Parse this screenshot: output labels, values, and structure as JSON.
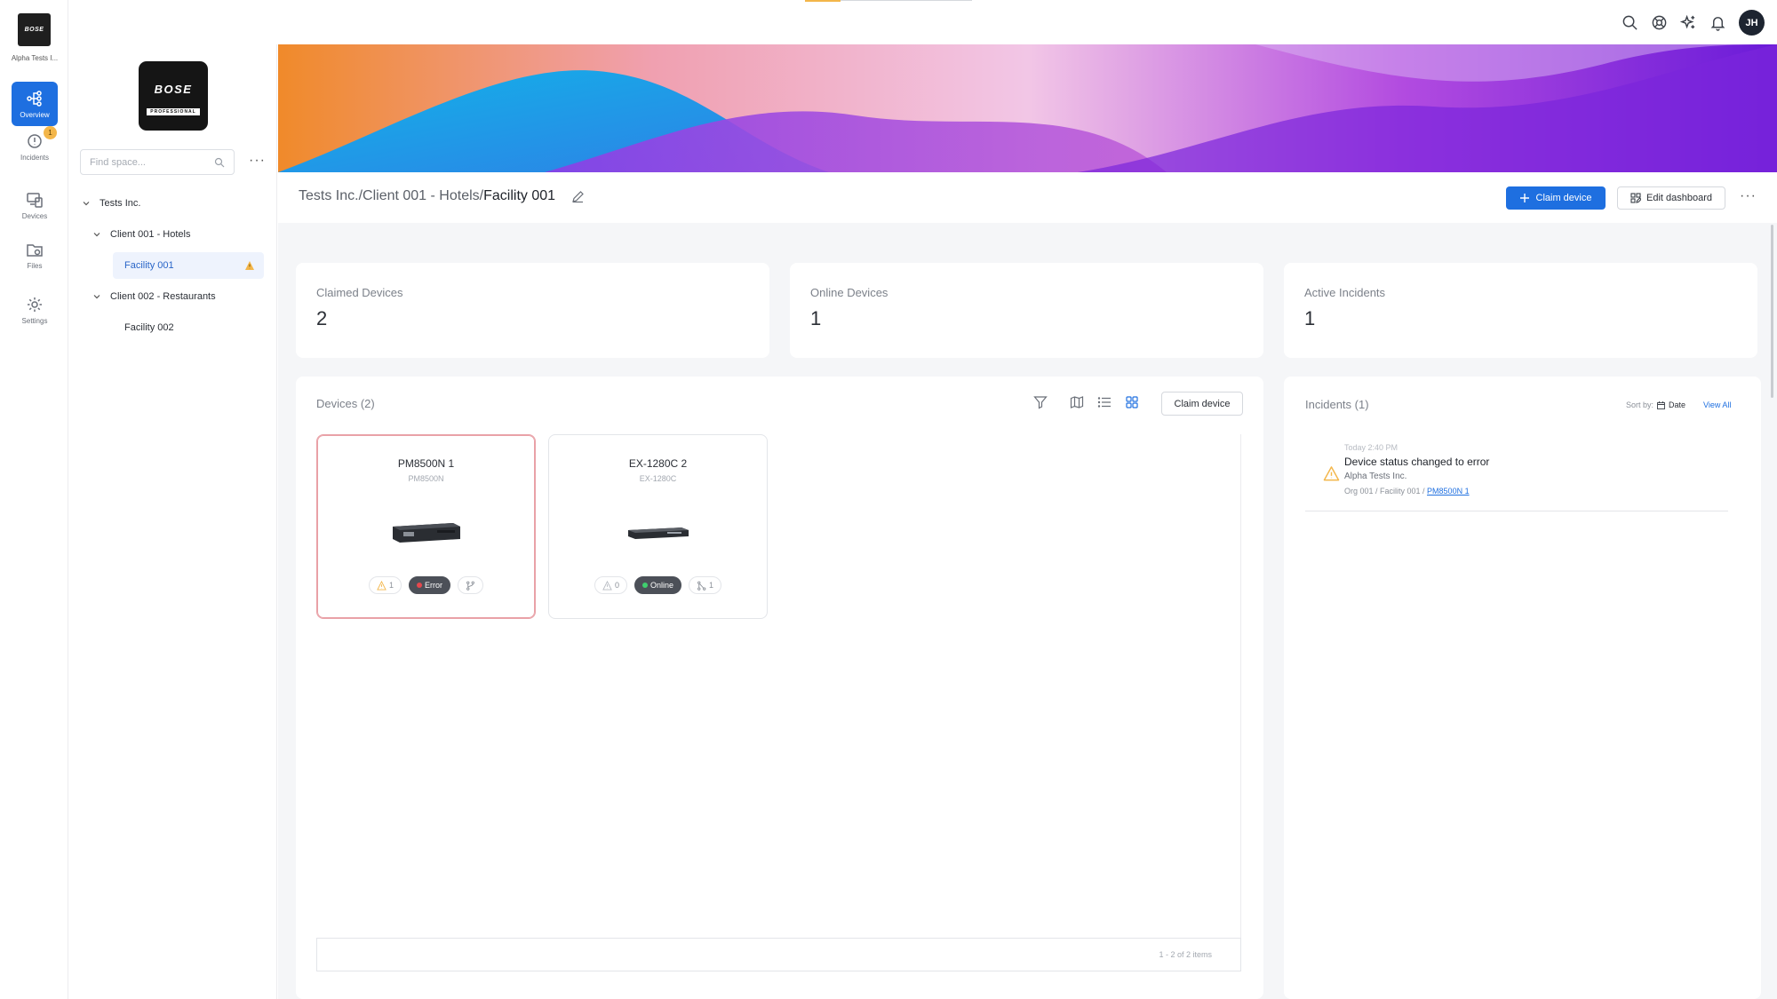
{
  "rail": {
    "org_label": "Alpha Tests I...",
    "items": [
      {
        "label": "Overview"
      },
      {
        "label": "Incidents",
        "badge": "1"
      },
      {
        "label": "Devices"
      },
      {
        "label": "Files"
      },
      {
        "label": "Settings"
      }
    ]
  },
  "tree": {
    "brand_mark": "BOSE",
    "brand_sub": "PROFESSIONAL",
    "search_placeholder": "Find space...",
    "more": "···",
    "nodes": [
      {
        "label": "Tests Inc."
      },
      {
        "label": "Client 001 - Hotels"
      },
      {
        "label": "Facility 001"
      },
      {
        "label": "Client 002 - Restaurants"
      },
      {
        "label": "Facility 002"
      }
    ]
  },
  "topbar": {
    "avatar_initials": "JH"
  },
  "header": {
    "crumb_1": "Tests Inc.",
    "crumb_2": "Client 001 - Hotels",
    "crumb_current": "Facility 001",
    "sep": "/",
    "claim_label": "Claim device",
    "edit_label": "Edit dashboard",
    "more": "···"
  },
  "stats": [
    {
      "label": "Claimed Devices",
      "value": "2"
    },
    {
      "label": "Online Devices",
      "value": "1"
    },
    {
      "label": "Active Incidents",
      "value": "1"
    }
  ],
  "devices": {
    "title": "Devices (2)",
    "claim_label": "Claim device",
    "pager_text": "1 - 2 of 2 items",
    "items": [
      {
        "name": "PM8500N 1",
        "model": "PM8500N",
        "warn_count": "1",
        "status": "Error",
        "status_color": "#e5484d",
        "link_count": ""
      },
      {
        "name": "EX-1280C 2",
        "model": "EX-1280C",
        "warn_count": "0",
        "status": "Online",
        "status_color": "#3fcf6e",
        "link_count": "1"
      }
    ]
  },
  "incidents": {
    "title": "Incidents (1)",
    "sort_label": "Sort by:",
    "sort_value": "Date",
    "view_all": "View All",
    "items": [
      {
        "time": "Today 2:40 PM",
        "title": "Device status changed to error",
        "org": "Alpha Tests Inc.",
        "path": "Org 001 / Facility 001 / ",
        "link": "PM8500N 1"
      }
    ]
  },
  "colors": {
    "accent": "#1e6fe0",
    "warning": "#f3b64a",
    "error": "#e5484d",
    "online": "#3fcf6e"
  }
}
